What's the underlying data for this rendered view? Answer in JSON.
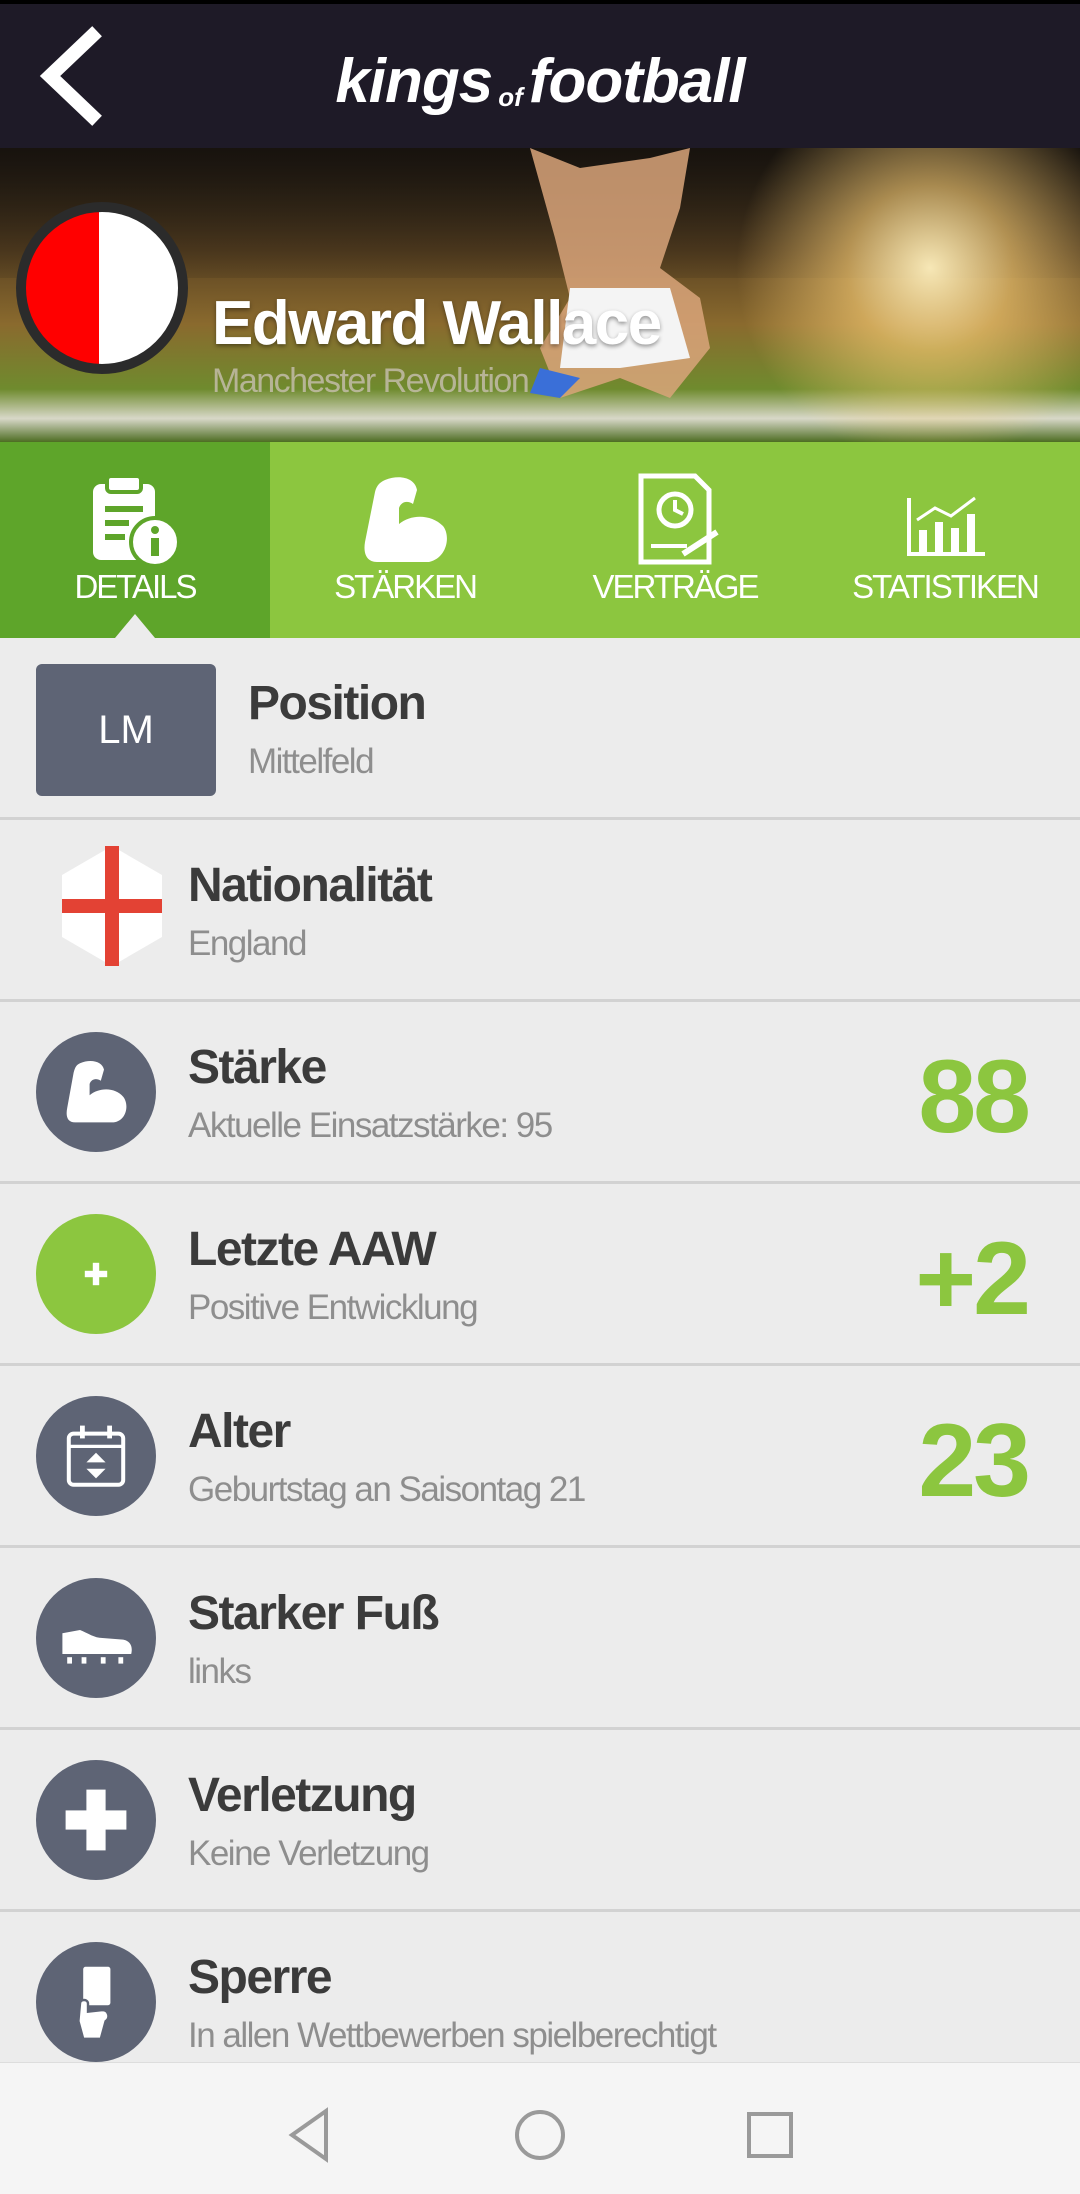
{
  "header": {
    "logo_kings": "kings",
    "logo_of": "of",
    "logo_football": "football",
    "back_icon": "chevron-left-icon"
  },
  "player": {
    "name": "Edward Wallace",
    "club": "Manchester Revolution",
    "club_colors": [
      "#ff0000",
      "#ffffff"
    ]
  },
  "tabs": [
    {
      "label": "DETAILS",
      "icon": "clipboard-info-icon",
      "active": true
    },
    {
      "label": "STÄRKEN",
      "icon": "flexed-arm-icon",
      "active": false
    },
    {
      "label": "VERTRÄGE",
      "icon": "contract-icon",
      "active": false
    },
    {
      "label": "STATISTIKEN",
      "icon": "bar-chart-icon",
      "active": false
    }
  ],
  "details": {
    "position": {
      "badge": "LM",
      "title": "Position",
      "sub": "Mittelfeld"
    },
    "nationality": {
      "title": "Nationalität",
      "sub": "England",
      "icon": "england-flag-icon"
    },
    "strength": {
      "title": "Stärke",
      "sub": "Aktuelle Einsatzstärke: 95",
      "value": "88",
      "icon": "flexed-arm-icon"
    },
    "last_aaw": {
      "title": "Letzte AAW",
      "sub": "Positive Entwicklung",
      "value": "+2",
      "icon": "plus-icon"
    },
    "age": {
      "title": "Alter",
      "sub": "Geburtstag an Saisontag 21",
      "value": "23",
      "icon": "calendar-icon"
    },
    "foot": {
      "title": "Starker Fuß",
      "sub": "links",
      "icon": "football-boot-icon"
    },
    "injury": {
      "title": "Verletzung",
      "sub": "Keine Verletzung",
      "icon": "medical-cross-icon"
    },
    "suspension": {
      "title": "Sperre",
      "sub": "In allen Wettbewerben spielberechtigt",
      "icon": "card-hand-icon"
    }
  },
  "colors": {
    "accent": "#8cc63f",
    "accent_dark": "#5ea52a",
    "header_bg": "#1e1a27",
    "icon_bg": "#5e6475"
  },
  "navbar": {
    "back": "nav-back-icon",
    "home": "nav-home-icon",
    "recents": "nav-recents-icon"
  }
}
